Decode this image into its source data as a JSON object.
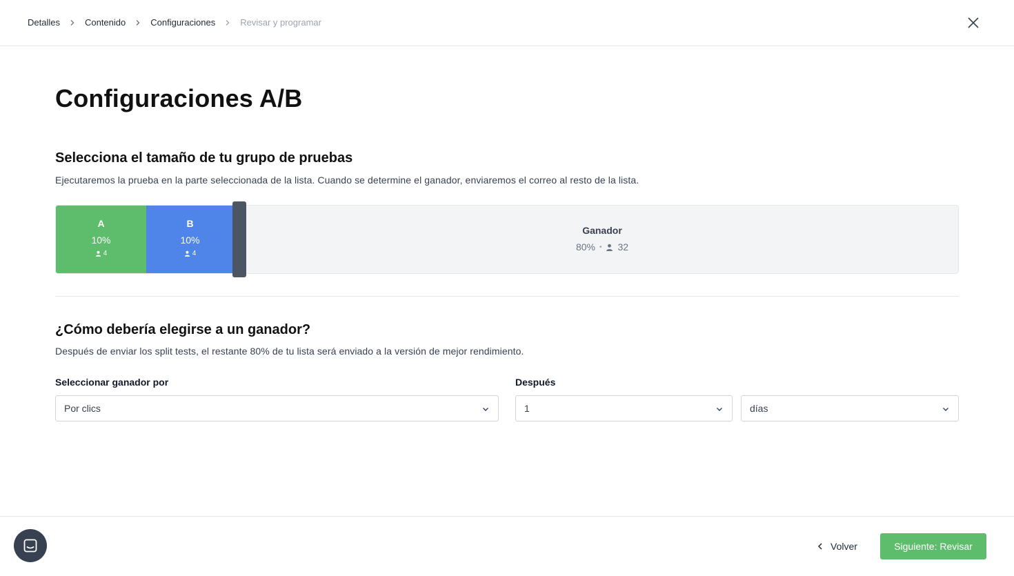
{
  "breadcrumb": {
    "items": [
      {
        "label": "Detalles",
        "state": "done"
      },
      {
        "label": "Contenido",
        "state": "done"
      },
      {
        "label": "Configuraciones",
        "state": "current"
      },
      {
        "label": "Revisar y programar",
        "state": "upcoming"
      }
    ],
    "separator_icon": "chevron-right-icon"
  },
  "close_icon": "close-icon",
  "page_title": "Configuraciones A/B",
  "test_group": {
    "title": "Selecciona el tamaño de tu grupo de pruebas",
    "description": "Ejecutaremos la prueba en la parte seleccionada de la lista. Cuando se determine el ganador, enviaremos el correo al resto de la lista.",
    "variant_a": {
      "label": "A",
      "percent": "10%",
      "count": "4",
      "fraction": 0.1,
      "color": "#5ebd6c"
    },
    "variant_b": {
      "label": "B",
      "percent": "10%",
      "count": "4",
      "fraction": 0.1,
      "color": "#4f84e8"
    },
    "winner": {
      "label": "Ganador",
      "percent": "80%",
      "count": "32",
      "fraction": 0.8
    },
    "handle_color": "#4b5563",
    "person_icon": "user-icon"
  },
  "winner_section": {
    "title": "¿Cómo debería elegirse a un ganador?",
    "description": "Después de enviar los split tests, el restante 80% de tu lista será enviado a la versión de mejor rendimiento.",
    "select_by": {
      "label": "Seleccionar ganador por",
      "value": "Por clics"
    },
    "after": {
      "label": "Después",
      "value": "1",
      "unit": "días"
    }
  },
  "footer": {
    "back_label": "Volver",
    "next_label": "Siguiente: Revisar",
    "next_color": "#5ebd6c",
    "chat_icon": "chat-icon"
  }
}
